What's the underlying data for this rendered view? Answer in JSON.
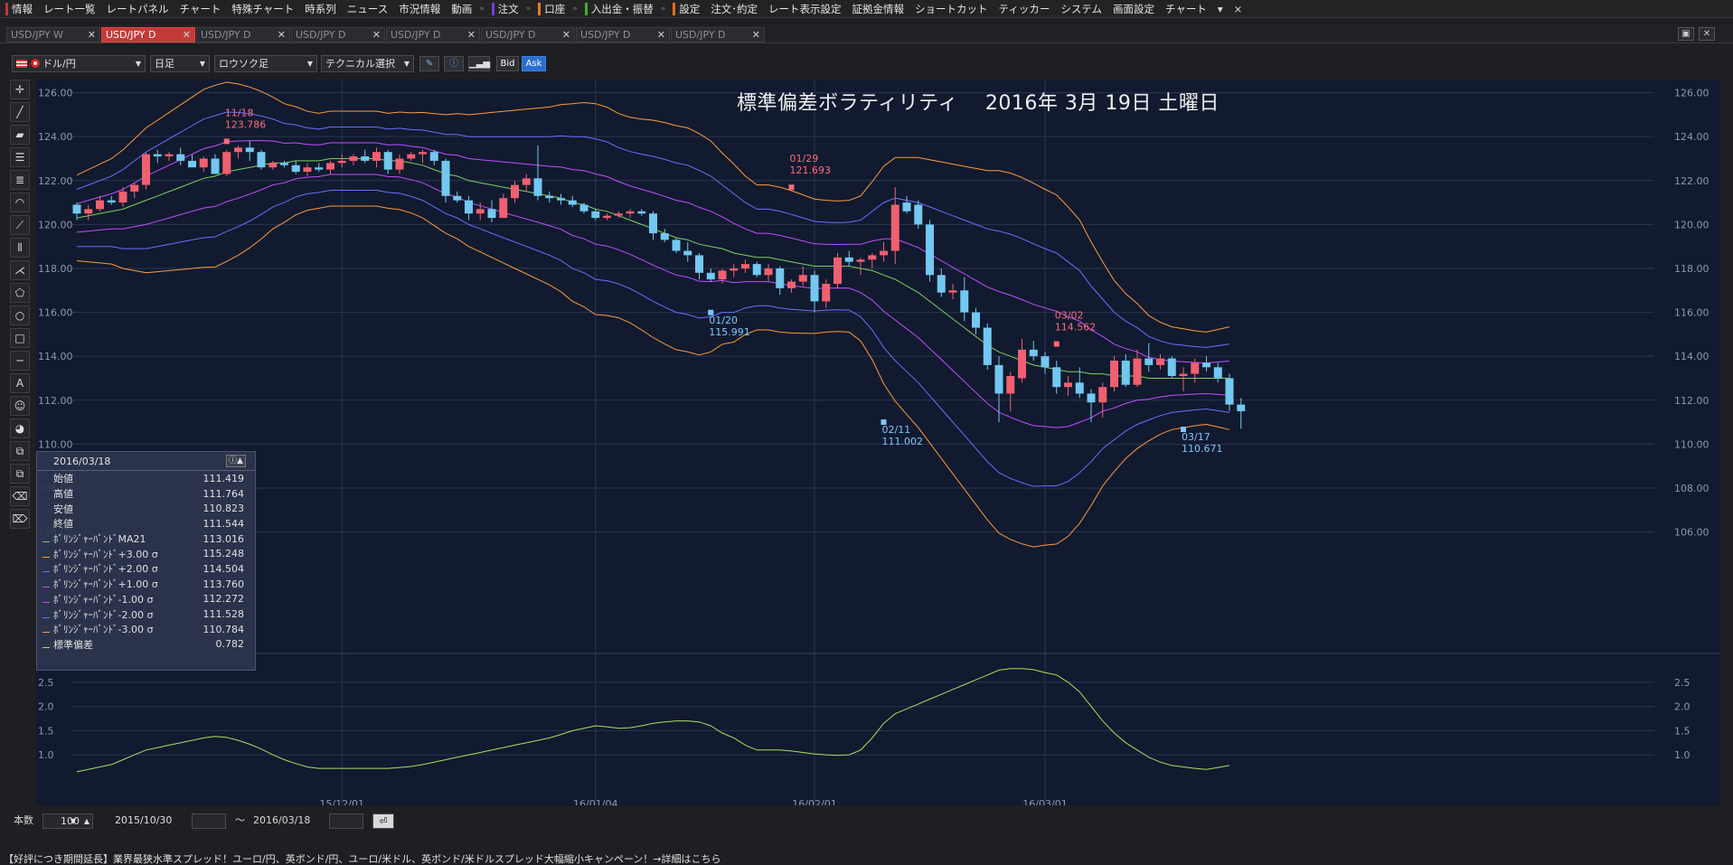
{
  "menu": {
    "items": [
      {
        "label": "情報",
        "mark": "#d03030"
      },
      {
        "label": "レート一覧",
        "mark": ""
      },
      {
        "label": "レートパネル",
        "mark": ""
      },
      {
        "label": "チャート",
        "mark": ""
      },
      {
        "label": "特殊チャート",
        "mark": ""
      },
      {
        "label": "時系列",
        "mark": ""
      },
      {
        "label": "ニュース",
        "mark": ""
      },
      {
        "label": "市況情報",
        "mark": ""
      },
      {
        "label": "動画",
        "mark": ""
      },
      {
        "label": "注文",
        "mark": "#7a3ad8"
      },
      {
        "label": "口座",
        "mark": "#e08020"
      },
      {
        "label": "入出金・振替",
        "mark": "#3ab030"
      },
      {
        "label": "設定",
        "mark": "#e07020"
      },
      {
        "label": "注文･約定",
        "mark": ""
      },
      {
        "label": "レート表示設定",
        "mark": ""
      },
      {
        "label": "証拠金情報",
        "mark": ""
      },
      {
        "label": "ショートカット",
        "mark": ""
      },
      {
        "label": "ティッカー",
        "mark": ""
      },
      {
        "label": "システム",
        "mark": ""
      },
      {
        "label": "画面設定",
        "mark": ""
      },
      {
        "label": "チャート",
        "mark": ""
      }
    ],
    "close": "×"
  },
  "tabs": [
    {
      "label": "USD/JPY W",
      "active": false
    },
    {
      "label": "USD/JPY D",
      "active": true
    },
    {
      "label": "USD/JPY D",
      "active": false
    },
    {
      "label": "USD/JPY D",
      "active": false
    },
    {
      "label": "USD/JPY D",
      "active": false
    },
    {
      "label": "USD/JPY D",
      "active": false
    },
    {
      "label": "USD/JPY D",
      "active": false
    },
    {
      "label": "USD/JPY D",
      "active": false
    }
  ],
  "toolbar": {
    "pair": "ドル/円",
    "period": "日足",
    "chart_type": "ロウソク足",
    "technical": "テクニカル選択",
    "bid": "Bid",
    "ask": "Ask"
  },
  "chart_title": "標準偏差ボラティリティ　 2016年 3月 19日 土曜日",
  "info": {
    "date": "2016/03/18",
    "rows": [
      {
        "label": "始値",
        "value": "111.419",
        "color": ""
      },
      {
        "label": "高値",
        "value": "111.764",
        "color": ""
      },
      {
        "label": "安値",
        "value": "110.823",
        "color": ""
      },
      {
        "label": "終値",
        "value": "111.544",
        "color": ""
      },
      {
        "label": "ﾎﾞﾘﾝｼﾞｬｰﾊﾞﾝﾄﾞMA21",
        "value": "113.016",
        "color": "#7ed060"
      },
      {
        "label": "ﾎﾞﾘﾝｼﾞｬｰﾊﾞﾝﾄﾞ+3.00 σ",
        "value": "115.248",
        "color": "#ff9a3c"
      },
      {
        "label": "ﾎﾞﾘﾝｼﾞｬｰﾊﾞﾝﾄﾞ+2.00 σ",
        "value": "114.504",
        "color": "#6a70ff"
      },
      {
        "label": "ﾎﾞﾘﾝｼﾞｬｰﾊﾞﾝﾄﾞ+1.00 σ",
        "value": "113.760",
        "color": "#c050ff"
      },
      {
        "label": "ﾎﾞﾘﾝｼﾞｬｰﾊﾞﾝﾄﾞ-1.00 σ",
        "value": "112.272",
        "color": "#c050ff"
      },
      {
        "label": "ﾎﾞﾘﾝｼﾞｬｰﾊﾞﾝﾄﾞ-2.00 σ",
        "value": "111.528",
        "color": "#6a70ff"
      },
      {
        "label": "ﾎﾞﾘﾝｼﾞｬｰﾊﾞﾝﾄﾞ-3.00 σ",
        "value": "110.784",
        "color": "#ff9a3c"
      },
      {
        "label": "標準偏差",
        "value": "0.782",
        "color": "#a8e060"
      }
    ]
  },
  "bottom": {
    "count_label": "本数",
    "count": "100",
    "from": "2015/10/30",
    "tilde": "～",
    "to": "2016/03/18"
  },
  "ticker": "【好評につき期間延長】業界最狭水準スプレッド！ユーロ/円、英ポンド/円、ユーロ/米ドル、英ポンド/米ドルスプレッド大幅縮小キャンペーン！→詳細はこちら",
  "chart_data": {
    "type": "candlestick",
    "symbol": "USD/JPY",
    "price_ticks": [
      "106.00",
      "108.00",
      "110.00",
      "112.00",
      "114.00",
      "116.00",
      "118.00",
      "120.00",
      "122.00",
      "124.00",
      "126.00"
    ],
    "ylim": [
      105.2,
      126.6
    ],
    "date_ticks": [
      {
        "label": "15/12/01",
        "idx": 23
      },
      {
        "label": "16/01/04",
        "idx": 45
      },
      {
        "label": "16/02/01",
        "idx": 64
      },
      {
        "label": "16/03/01",
        "idx": 84
      }
    ],
    "annotations": [
      {
        "date": "11/18",
        "price": "123.786",
        "idx": 13,
        "kind": "high",
        "color": "#ff6a7a"
      },
      {
        "date": "01/29",
        "price": "121.693",
        "idx": 62,
        "kind": "high",
        "color": "#ff6a7a"
      },
      {
        "date": "01/20",
        "price": "115.991",
        "idx": 55,
        "kind": "low",
        "color": "#7ec8ff"
      },
      {
        "date": "03/02",
        "price": "114.562",
        "idx": 85,
        "kind": "high",
        "color": "#ff6a7a"
      },
      {
        "date": "02/11",
        "price": "111.002",
        "idx": 70,
        "kind": "low",
        "color": "#7ec8ff"
      },
      {
        "date": "03/17",
        "price": "110.671",
        "idx": 96,
        "kind": "low",
        "color": "#7ec8ff"
      }
    ],
    "candles": [
      [
        120.9,
        120.2,
        121.0,
        120.5
      ],
      [
        120.5,
        120.2,
        120.9,
        120.7
      ],
      [
        120.7,
        120.6,
        121.3,
        121.1
      ],
      [
        121.1,
        120.9,
        121.3,
        121.0
      ],
      [
        121.0,
        120.8,
        121.7,
        121.5
      ],
      [
        121.5,
        121.2,
        121.9,
        121.8
      ],
      [
        121.8,
        121.6,
        123.3,
        123.2
      ],
      [
        123.2,
        122.8,
        123.4,
        123.1
      ],
      [
        123.1,
        122.9,
        123.3,
        123.2
      ],
      [
        123.2,
        122.7,
        123.5,
        122.9
      ],
      [
        122.9,
        122.7,
        123.2,
        122.6
      ],
      [
        122.6,
        122.4,
        123.1,
        123.0
      ],
      [
        123.0,
        122.5,
        123.2,
        122.3
      ],
      [
        122.3,
        122.2,
        123.4,
        123.3
      ],
      [
        123.3,
        123.0,
        123.6,
        123.5
      ],
      [
        123.5,
        122.9,
        123.8,
        123.3
      ],
      [
        123.3,
        122.5,
        123.4,
        122.6
      ],
      [
        122.6,
        122.5,
        122.9,
        122.8
      ],
      [
        122.8,
        122.6,
        122.9,
        122.7
      ],
      [
        122.7,
        122.3,
        122.9,
        122.4
      ],
      [
        122.4,
        122.2,
        122.8,
        122.6
      ],
      [
        122.6,
        122.4,
        122.8,
        122.5
      ],
      [
        122.5,
        122.3,
        122.9,
        122.8
      ],
      [
        122.8,
        122.6,
        123.2,
        122.9
      ],
      [
        122.9,
        122.7,
        123.2,
        123.1
      ],
      [
        123.1,
        122.8,
        123.4,
        122.9
      ],
      [
        122.9,
        122.6,
        123.5,
        123.3
      ],
      [
        123.3,
        122.3,
        123.4,
        122.5
      ],
      [
        122.5,
        122.3,
        123.2,
        123.0
      ],
      [
        123.0,
        122.9,
        123.3,
        123.2
      ],
      [
        123.2,
        122.8,
        123.4,
        123.3
      ],
      [
        123.3,
        122.7,
        123.4,
        122.9
      ],
      [
        122.9,
        121.0,
        123.0,
        121.3
      ],
      [
        121.3,
        121.0,
        121.5,
        121.1
      ],
      [
        121.1,
        120.2,
        121.3,
        120.5
      ],
      [
        120.5,
        120.2,
        121.0,
        120.7
      ],
      [
        120.7,
        120.1,
        121.1,
        120.3
      ],
      [
        120.3,
        120.3,
        121.4,
        121.2
      ],
      [
        121.2,
        121.0,
        122.0,
        121.8
      ],
      [
        121.8,
        121.5,
        122.3,
        122.1
      ],
      [
        122.1,
        121.1,
        123.6,
        121.3
      ],
      [
        121.3,
        121.0,
        121.5,
        121.2
      ],
      [
        121.2,
        120.9,
        121.4,
        121.1
      ],
      [
        121.1,
        120.8,
        121.3,
        120.9
      ],
      [
        120.9,
        120.5,
        121.0,
        120.6
      ],
      [
        120.6,
        120.2,
        120.7,
        120.3
      ],
      [
        120.3,
        120.2,
        120.5,
        120.4
      ],
      [
        120.4,
        120.3,
        120.6,
        120.5
      ],
      [
        120.5,
        120.3,
        120.7,
        120.6
      ],
      [
        120.6,
        120.4,
        120.7,
        120.5
      ],
      [
        120.5,
        119.3,
        120.6,
        119.6
      ],
      [
        119.6,
        119.2,
        119.8,
        119.3
      ],
      [
        119.3,
        118.7,
        119.4,
        118.8
      ],
      [
        118.8,
        118.3,
        119.2,
        118.6
      ],
      [
        118.6,
        117.5,
        118.7,
        117.8
      ],
      [
        117.8,
        117.4,
        118.0,
        117.5
      ],
      [
        117.5,
        117.3,
        118.0,
        117.9
      ],
      [
        117.9,
        117.6,
        118.2,
        118.0
      ],
      [
        118.0,
        117.8,
        118.4,
        118.2
      ],
      [
        118.2,
        117.6,
        118.3,
        117.7
      ],
      [
        117.7,
        117.4,
        118.2,
        118.0
      ],
      [
        118.0,
        116.8,
        118.1,
        117.1
      ],
      [
        117.1,
        116.9,
        117.5,
        117.4
      ],
      [
        117.4,
        117.2,
        118.1,
        117.7
      ],
      [
        117.7,
        116.0,
        117.9,
        116.5
      ],
      [
        116.5,
        116.2,
        117.5,
        117.3
      ],
      [
        117.3,
        117.1,
        118.7,
        118.5
      ],
      [
        118.5,
        118.1,
        118.8,
        118.3
      ],
      [
        118.3,
        117.7,
        118.5,
        118.4
      ],
      [
        118.4,
        118.0,
        118.7,
        118.6
      ],
      [
        118.6,
        118.3,
        119.2,
        118.8
      ],
      [
        118.8,
        118.2,
        121.7,
        120.9
      ],
      [
        121.0,
        120.5,
        121.3,
        120.6
      ],
      [
        120.9,
        119.8,
        121.1,
        120.0
      ],
      [
        120.0,
        117.4,
        120.2,
        117.7
      ],
      [
        117.7,
        116.7,
        118.0,
        116.9
      ],
      [
        116.9,
        116.6,
        117.3,
        117.0
      ],
      [
        117.0,
        115.6,
        117.6,
        116.0
      ],
      [
        116.0,
        115.0,
        116.2,
        115.3
      ],
      [
        115.3,
        113.4,
        115.5,
        113.6
      ],
      [
        113.6,
        111.0,
        114.0,
        112.3
      ],
      [
        112.3,
        111.5,
        113.3,
        113.1
      ],
      [
        113.0,
        112.8,
        114.8,
        114.3
      ],
      [
        114.3,
        113.8,
        114.7,
        114.0
      ],
      [
        114.0,
        113.2,
        114.2,
        113.5
      ],
      [
        113.5,
        112.3,
        113.8,
        112.6
      ],
      [
        112.6,
        112.2,
        113.1,
        112.8
      ],
      [
        112.8,
        112.1,
        113.5,
        112.3
      ],
      [
        112.3,
        111.0,
        112.5,
        111.9
      ],
      [
        111.9,
        111.2,
        112.8,
        112.6
      ],
      [
        112.6,
        112.4,
        114.0,
        113.8
      ],
      [
        113.8,
        112.6,
        114.1,
        112.7
      ],
      [
        112.7,
        112.6,
        114.3,
        113.9
      ],
      [
        113.9,
        113.3,
        114.6,
        113.6
      ],
      [
        113.6,
        113.4,
        114.1,
        113.9
      ],
      [
        113.9,
        113.0,
        114.0,
        113.1
      ],
      [
        113.1,
        112.4,
        113.5,
        113.2
      ],
      [
        113.2,
        112.8,
        113.9,
        113.7
      ],
      [
        113.7,
        113.3,
        114.0,
        113.5
      ],
      [
        113.5,
        112.8,
        113.7,
        113.0
      ],
      [
        113.0,
        111.5,
        113.2,
        111.8
      ],
      [
        111.8,
        110.7,
        112.1,
        111.5
      ]
    ],
    "bands": {
      "ma21": [
        120.3,
        120.4,
        120.5,
        120.6,
        120.7,
        120.9,
        121.1,
        121.3,
        121.5,
        121.7,
        121.9,
        122.1,
        122.2,
        122.4,
        122.5,
        122.6,
        122.7,
        122.8,
        122.8,
        122.9,
        122.9,
        122.9,
        123.0,
        123.0,
        123.0,
        123.0,
        123.0,
        122.9,
        122.9,
        122.8,
        122.7,
        122.5,
        122.3,
        122.2,
        122.0,
        121.9,
        121.8,
        121.7,
        121.6,
        121.5,
        121.4,
        121.3,
        121.2,
        121.0,
        120.9,
        120.7,
        120.6,
        120.4,
        120.2,
        120.0,
        119.8,
        119.6,
        119.4,
        119.3,
        119.1,
        119.0,
        118.9,
        118.7,
        118.6,
        118.5,
        118.5,
        118.4,
        118.3,
        118.2,
        118.1,
        118.1,
        118.1,
        118.1,
        118.0,
        117.9,
        117.7,
        117.5,
        117.2,
        116.9,
        116.5,
        116.1,
        115.7,
        115.3,
        114.9,
        114.5,
        114.2,
        114.0,
        113.8,
        113.6,
        113.5,
        113.4,
        113.3,
        113.3,
        113.2,
        113.2,
        113.1,
        113.1,
        113.1,
        113.0,
        113.0,
        113.0,
        113.0,
        113.0,
        113.0,
        113.0,
        113.0
      ],
      "sd": [
        0.65,
        0.7,
        0.75,
        0.8,
        0.9,
        1.0,
        1.1,
        1.15,
        1.2,
        1.25,
        1.3,
        1.35,
        1.38,
        1.36,
        1.3,
        1.22,
        1.12,
        1.0,
        0.9,
        0.82,
        0.75,
        0.72,
        0.72,
        0.72,
        0.72,
        0.72,
        0.72,
        0.72,
        0.74,
        0.76,
        0.8,
        0.85,
        0.9,
        0.95,
        1.0,
        1.05,
        1.1,
        1.15,
        1.2,
        1.25,
        1.3,
        1.35,
        1.42,
        1.5,
        1.55,
        1.6,
        1.58,
        1.55,
        1.56,
        1.6,
        1.65,
        1.68,
        1.7,
        1.7,
        1.68,
        1.6,
        1.45,
        1.35,
        1.2,
        1.1,
        1.1,
        1.1,
        1.08,
        1.05,
        1.02,
        1.0,
        0.99,
        1.0,
        1.1,
        1.35,
        1.65,
        1.85,
        1.95,
        2.05,
        2.15,
        2.25,
        2.35,
        2.45,
        2.55,
        2.65,
        2.75,
        2.78,
        2.78,
        2.76,
        2.7,
        2.65,
        2.5,
        2.3,
        2.0,
        1.7,
        1.45,
        1.25,
        1.1,
        0.95,
        0.85,
        0.78,
        0.75,
        0.72,
        0.7,
        0.74,
        0.78
      ]
    }
  }
}
